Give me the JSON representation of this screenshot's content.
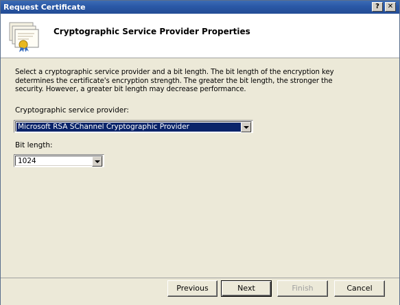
{
  "window": {
    "title": "Request Certificate"
  },
  "titlebar": {
    "help_label": "?",
    "close_label": "✕"
  },
  "header": {
    "title": "Cryptographic Service Provider Properties"
  },
  "main": {
    "description": "Select a cryptographic service provider and a bit length. The bit length of the encryption key determines the certificate's encryption strength. The greater the bit length, the stronger the security. However, a greater bit length may decrease performance.",
    "csp_label": "Cryptographic service provider:",
    "csp_value": "Microsoft RSA SChannel Cryptographic Provider",
    "bit_length_label": "Bit length:",
    "bit_length_value": "1024"
  },
  "footer": {
    "previous_label": "Previous",
    "next_label": "Next",
    "finish_label": "Finish",
    "cancel_label": "Cancel"
  },
  "colors": {
    "titlebar": "#2a58a6",
    "dialog_bg": "#ece9d8",
    "selection": "#0a246a"
  }
}
